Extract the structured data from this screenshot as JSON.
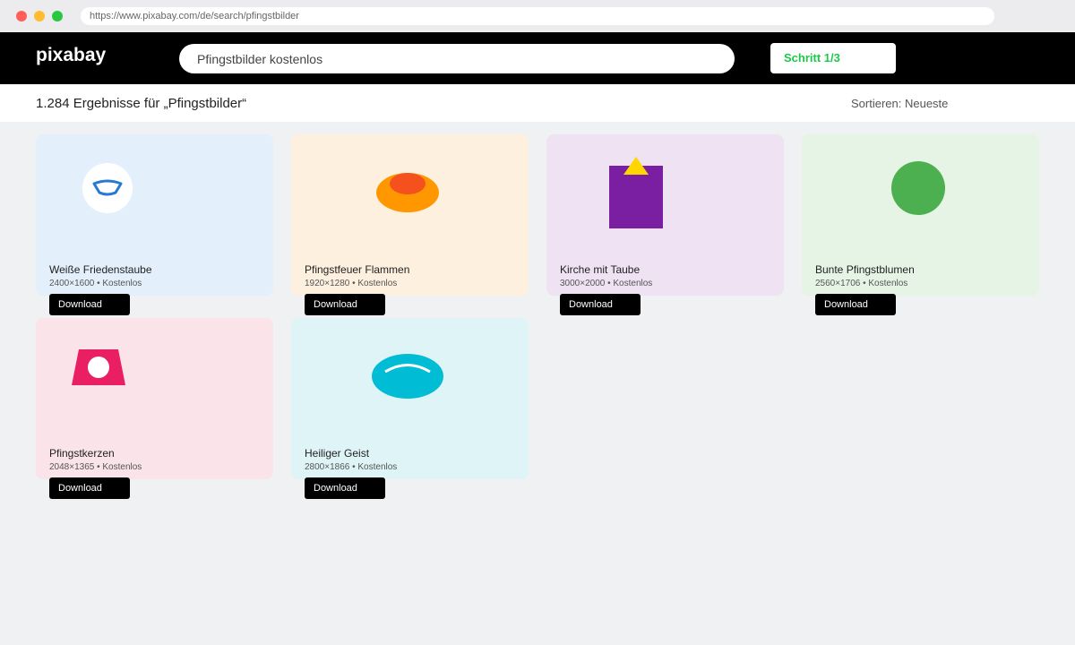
{
  "browser": {
    "url": "https://www.pixabay.com/de/search/pfingstbilder"
  },
  "header": {
    "logo": "pixabay",
    "search_value": "Pfingstbilder kostenlos",
    "step_label": "Schritt 1/3"
  },
  "results": {
    "count_text": "1.284 Ergebnisse für „Pfingstbilder“",
    "sort_text": "Sortieren: Neueste"
  },
  "cards": [
    {
      "title": "Weiße Friedenstaube",
      "meta": "2400×1600 • Kostenlos",
      "download": "Download",
      "bg": "#e3f0fb",
      "icon": "dove-icon"
    },
    {
      "title": "Pfingstfeuer Flammen",
      "meta": "1920×1280 • Kostenlos",
      "download": "Download",
      "bg": "#fdf0de",
      "icon": "flame-icon"
    },
    {
      "title": "Kirche mit Taube",
      "meta": "3000×2000 • Kostenlos",
      "download": "Download",
      "bg": "#efe2f2",
      "icon": "church-icon"
    },
    {
      "title": "Bunte Pfingstblumen",
      "meta": "2560×1706 • Kostenlos",
      "download": "Download",
      "bg": "#e6f4e6",
      "icon": "flower-icon"
    },
    {
      "title": "Pfingstkerzen",
      "meta": "2048×1365 • Kostenlos",
      "download": "Download",
      "bg": "#fbe3ea",
      "icon": "candle-icon"
    },
    {
      "title": "Heiliger Geist",
      "meta": "2800×1866 • Kostenlos",
      "download": "Download",
      "bg": "#def4f6",
      "icon": "holy-spirit-icon"
    }
  ],
  "colors": {
    "accent": "#1ec84a",
    "header_bg": "#000000"
  }
}
